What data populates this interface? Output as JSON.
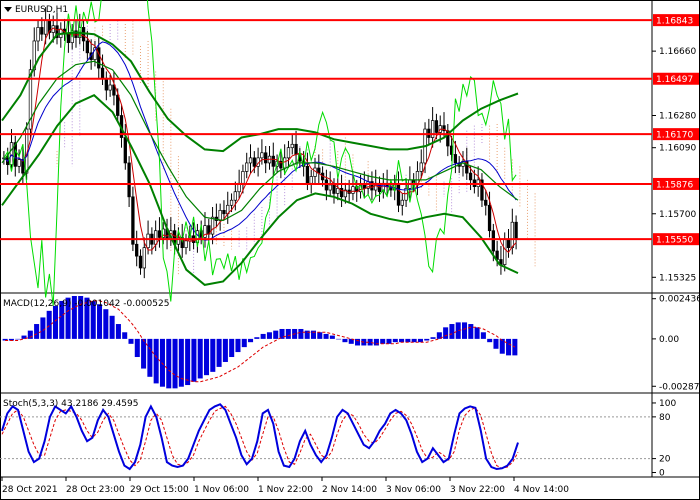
{
  "chart_data": [
    {
      "type": "candlestick",
      "title": "EURUSD,H1",
      "symbol_menu_icon": "triangle-down-icon",
      "y_range": [
        1.1525,
        1.1695
      ],
      "y_ticks": [
        "1.16660",
        "1.16280",
        "1.16090",
        "1.15700",
        "1.15325"
      ],
      "x_labels": [
        "28 Oct 2021",
        "28 Oct 23:00",
        "29 Oct 15:00",
        "1 Nov 06:00",
        "1 Nov 22:00",
        "2 Nov 14:00",
        "3 Nov 06:00",
        "3 Nov 22:00",
        "4 Nov 14:00"
      ],
      "levels": [
        {
          "label": "1.16843",
          "value": 1.16843
        },
        {
          "label": "1.16497",
          "value": 1.16497
        },
        {
          "label": "1.16170",
          "value": 1.1617
        },
        {
          "label": "1.15876",
          "value": 1.15876
        },
        {
          "label": "1.15550",
          "value": 1.1555
        }
      ],
      "colors": {
        "level_line": "#ff0000",
        "bollinger": "#008000",
        "ma_fast": "#cc0000",
        "ma_slow": "#0000cc",
        "price_line": "#00dd00",
        "cloud_orange": "#e07b39",
        "cloud_violet": "#9966cc",
        "candle": "#000000"
      },
      "series_closes": [
        1.1603,
        1.1599,
        1.1612,
        1.1598,
        1.1602,
        1.1594,
        1.162,
        1.1655,
        1.1672,
        1.168,
        1.1676,
        1.1684,
        1.1677,
        1.1681,
        1.1674,
        1.1679,
        1.1676,
        1.1671,
        1.1678,
        1.1674,
        1.168,
        1.1672,
        1.1665,
        1.1661,
        1.1668,
        1.1656,
        1.165,
        1.1643,
        1.1646,
        1.164,
        1.1628,
        1.1615,
        1.16,
        1.158,
        1.1552,
        1.1545,
        1.1538,
        1.155,
        1.1558,
        1.1552,
        1.156,
        1.1556,
        1.1561,
        1.1555,
        1.156,
        1.1552,
        1.1556,
        1.155,
        1.1554,
        1.1557,
        1.1553,
        1.156,
        1.1556,
        1.1563,
        1.1558,
        1.1568,
        1.1566,
        1.1572,
        1.157,
        1.1575,
        1.1578,
        1.1583,
        1.1588,
        1.1595,
        1.16,
        1.1603,
        1.1598,
        1.1603,
        1.1606,
        1.16,
        1.1604,
        1.1598,
        1.1601,
        1.1597,
        1.1603,
        1.1609,
        1.1611,
        1.1605,
        1.1601,
        1.1598,
        1.1588,
        1.1592,
        1.1597,
        1.1594,
        1.159,
        1.1584,
        1.1587,
        1.1582,
        1.1585,
        1.158,
        1.1584,
        1.1582,
        1.1586,
        1.1583,
        1.1587,
        1.1585,
        1.1589,
        1.1584,
        1.1588,
        1.1583,
        1.1588,
        1.1586,
        1.1584,
        1.1587,
        1.1575,
        1.1578,
        1.1585,
        1.159,
        1.1587,
        1.1595,
        1.16,
        1.162,
        1.1615,
        1.1625,
        1.1618,
        1.1622,
        1.1619,
        1.161,
        1.1605,
        1.16,
        1.1598,
        1.1601,
        1.1594,
        1.159,
        1.1586,
        1.159,
        1.1578,
        1.1575,
        1.156,
        1.1548,
        1.1543,
        1.154,
        1.1555,
        1.155,
        1.1565,
        1.1555
      ],
      "bollinger_upper": [
        1.1625,
        1.164,
        1.1662,
        1.1676,
        1.1677,
        1.1676,
        1.167,
        1.166,
        1.1642,
        1.1626,
        1.1616,
        1.1608,
        1.1607,
        1.1615,
        1.1617,
        1.162,
        1.162,
        1.1618,
        1.1614,
        1.1612,
        1.161,
        1.1608,
        1.1608,
        1.161,
        1.1615,
        1.1625,
        1.1632,
        1.1637,
        1.1641
      ],
      "bollinger_middle": [
        1.16,
        1.1615,
        1.1635,
        1.165,
        1.1658,
        1.166,
        1.1655,
        1.164,
        1.1618,
        1.1598,
        1.158,
        1.1568,
        1.1566,
        1.1572,
        1.1585,
        1.1595,
        1.16,
        1.16,
        1.1598,
        1.1595,
        1.1592,
        1.159,
        1.159,
        1.159,
        1.1595,
        1.16,
        1.1596,
        1.1586,
        1.1578
      ],
      "bollinger_lower": [
        1.1575,
        1.159,
        1.1605,
        1.1622,
        1.1635,
        1.164,
        1.163,
        1.161,
        1.1588,
        1.156,
        1.1537,
        1.1528,
        1.153,
        1.1541,
        1.1555,
        1.1568,
        1.1578,
        1.1582,
        1.158,
        1.1576,
        1.157,
        1.1567,
        1.1565,
        1.1568,
        1.157,
        1.1568,
        1.1556,
        1.154,
        1.1535
      ]
    },
    {
      "type": "histogram",
      "title": "MACD(12,26,9) -0.001042 -0.000525",
      "y_ticks": [
        "0.002436",
        "0.00",
        "-0.002874"
      ],
      "y_range": [
        -0.0031,
        0.0026
      ],
      "values": [
        -0.0001,
        -0.0001,
        0.0,
        0.0002,
        0.0005,
        0.0009,
        0.0013,
        0.0017,
        0.002,
        0.0023,
        0.0025,
        0.0026,
        0.0026,
        0.0025,
        0.0023,
        0.0021,
        0.0018,
        0.0014,
        0.0009,
        0.0004,
        -0.0003,
        -0.0011,
        -0.0018,
        -0.0023,
        -0.0027,
        -0.0029,
        -0.003,
        -0.003,
        -0.0029,
        -0.0028,
        -0.0026,
        -0.0024,
        -0.0022,
        -0.002,
        -0.0017,
        -0.0014,
        -0.0011,
        -0.0008,
        -0.0005,
        -0.0002,
        0.0001,
        0.0003,
        0.0004,
        0.0005,
        0.0006,
        0.0006,
        0.0006,
        0.0006,
        0.0005,
        0.0005,
        0.0004,
        0.0003,
        0.0002,
        0.0,
        -0.0002,
        -0.0003,
        -0.0004,
        -0.0004,
        -0.0004,
        -0.0004,
        -0.0003,
        -0.0003,
        -0.0002,
        -0.0002,
        -0.0002,
        -0.0002,
        -0.0002,
        -0.0001,
        0.0001,
        0.0004,
        0.0007,
        0.0009,
        0.001,
        0.001,
        0.0009,
        0.0007,
        0.0004,
        -0.0002,
        -0.0006,
        -0.0009,
        -0.001,
        -0.001
      ],
      "signal": [
        -0.0001,
        -0.0001,
        -0.0001,
        0.0,
        0.0001,
        0.0003,
        0.0005,
        0.0008,
        0.0011,
        0.0014,
        0.0017,
        0.0019,
        0.0021,
        0.0022,
        0.0023,
        0.0023,
        0.0022,
        0.002,
        0.0018,
        0.0014,
        0.001,
        0.0005,
        -0.0001,
        -0.0006,
        -0.0011,
        -0.0015,
        -0.0019,
        -0.0022,
        -0.0024,
        -0.0025,
        -0.0026,
        -0.0026,
        -0.0025,
        -0.0024,
        -0.0023,
        -0.0021,
        -0.0019,
        -0.0017,
        -0.0014,
        -0.0011,
        -0.0008,
        -0.0005,
        -0.0003,
        -0.0001,
        0.0001,
        0.0002,
        0.0003,
        0.0004,
        0.0004,
        0.0004,
        0.0004,
        0.0004,
        0.0003,
        0.0002,
        0.0001,
        0.0,
        -0.0001,
        -0.0002,
        -0.0002,
        -0.0003,
        -0.0003,
        -0.0003,
        -0.0003,
        -0.0002,
        -0.0002,
        -0.0002,
        -0.0002,
        -0.0002,
        -0.0001,
        0.0,
        0.0002,
        0.0003,
        0.0005,
        0.0006,
        0.0007,
        0.0007,
        0.0006,
        0.0004,
        0.0002,
        -0.0001,
        -0.0003,
        -0.0005
      ],
      "colors": {
        "bars": "#0000dd",
        "signal": "#dd0000"
      }
    },
    {
      "type": "line",
      "title": "Stoch(5,3,3) 43.2186 29.4595",
      "y_ticks": [
        "100",
        "80",
        "20",
        "0"
      ],
      "y_range": [
        -5,
        110
      ],
      "levels": [
        80,
        20
      ],
      "k": [
        60,
        85,
        95,
        90,
        60,
        30,
        15,
        20,
        45,
        80,
        95,
        90,
        85,
        95,
        80,
        60,
        45,
        50,
        75,
        90,
        80,
        55,
        30,
        10,
        5,
        15,
        40,
        80,
        95,
        80,
        50,
        15,
        10,
        8,
        10,
        20,
        40,
        60,
        75,
        90,
        95,
        98,
        90,
        70,
        50,
        25,
        12,
        20,
        45,
        85,
        90,
        70,
        30,
        10,
        8,
        20,
        45,
        60,
        40,
        25,
        15,
        25,
        50,
        80,
        90,
        85,
        70,
        55,
        40,
        35,
        45,
        60,
        70,
        85,
        90,
        85,
        75,
        55,
        30,
        15,
        20,
        35,
        25,
        15,
        20,
        55,
        85,
        92,
        95,
        93,
        60,
        20,
        8,
        5,
        6,
        10,
        20,
        43
      ],
      "d": [
        55,
        70,
        85,
        90,
        80,
        60,
        40,
        25,
        25,
        50,
        75,
        88,
        90,
        88,
        85,
        75,
        60,
        50,
        58,
        75,
        85,
        75,
        55,
        35,
        18,
        10,
        18,
        45,
        75,
        85,
        75,
        50,
        25,
        12,
        10,
        15,
        25,
        45,
        60,
        75,
        88,
        92,
        95,
        85,
        70,
        50,
        30,
        18,
        28,
        55,
        80,
        80,
        60,
        35,
        15,
        12,
        28,
        48,
        55,
        40,
        25,
        20,
        30,
        55,
        75,
        85,
        82,
        70,
        55,
        45,
        42,
        50,
        62,
        75,
        85,
        88,
        82,
        70,
        52,
        32,
        20,
        22,
        30,
        25,
        18,
        30,
        62,
        82,
        90,
        93,
        82,
        55,
        28,
        10,
        6,
        8,
        15,
        29
      ],
      "colors": {
        "k": "#0000dd",
        "d": "#dd0000"
      }
    }
  ]
}
